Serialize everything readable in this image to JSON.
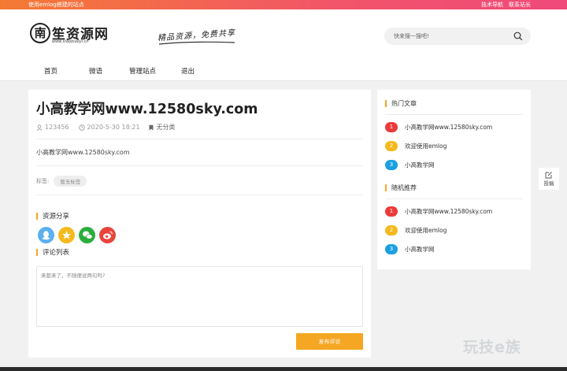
{
  "topbar": {
    "tagline": "使用emlog搭建的站点",
    "links": [
      "技术导航",
      "联系站长"
    ]
  },
  "logo": {
    "circle_char": "南",
    "text": "笙资源网",
    "domain": "www.xiaobiaoyi.cn"
  },
  "slogan": "精品资源，免费共享",
  "search": {
    "placeholder": "快来搜一搜吧!"
  },
  "nav": [
    "首页",
    "微语",
    "管理站点",
    "退出"
  ],
  "post": {
    "title": "小高教学网www.12580sky.com",
    "author": "123456",
    "date": "2020-5-30 18:21",
    "category": "无分类",
    "body": "小高教学网www.12580sky.com",
    "tags_label": "标签:",
    "tag": "暂无标签"
  },
  "share": {
    "heading": "资源分享",
    "icons": [
      {
        "name": "qq-icon",
        "color": "#5bb0ee"
      },
      {
        "name": "qzone-icon",
        "color": "#f5b91e"
      },
      {
        "name": "wechat-icon",
        "color": "#2bad3d"
      },
      {
        "name": "weibo-icon",
        "color": "#e8443b"
      }
    ]
  },
  "comments": {
    "heading": "评论列表",
    "placeholder": "来都来了，不随便说两句吗?",
    "submit_label": "发布评论"
  },
  "sidebar": {
    "hot": {
      "heading": "热门文章",
      "items": [
        {
          "num": "1",
          "title": "小高教学网www.12580sky.com",
          "color": "#ec3a3a"
        },
        {
          "num": "2",
          "title": "欢迎使用emlog",
          "color": "#f5b91e"
        },
        {
          "num": "3",
          "title": "小高教学网",
          "color": "#1aa0e0"
        }
      ]
    },
    "random": {
      "heading": "随机推荐",
      "items": [
        {
          "num": "1",
          "title": "小高教学网www.12580sky.com",
          "color": "#ec3a3a"
        },
        {
          "num": "2",
          "title": "欢迎使用emlog",
          "color": "#f5b91e"
        },
        {
          "num": "3",
          "title": "小高教学网",
          "color": "#1aa0e0"
        }
      ]
    }
  },
  "float_button": {
    "label": "投稿"
  },
  "watermark": "玩技e族",
  "colors": {
    "accent": "#f5a623",
    "topbar_start": "#f47a34",
    "topbar_end": "#ef4a7a"
  }
}
